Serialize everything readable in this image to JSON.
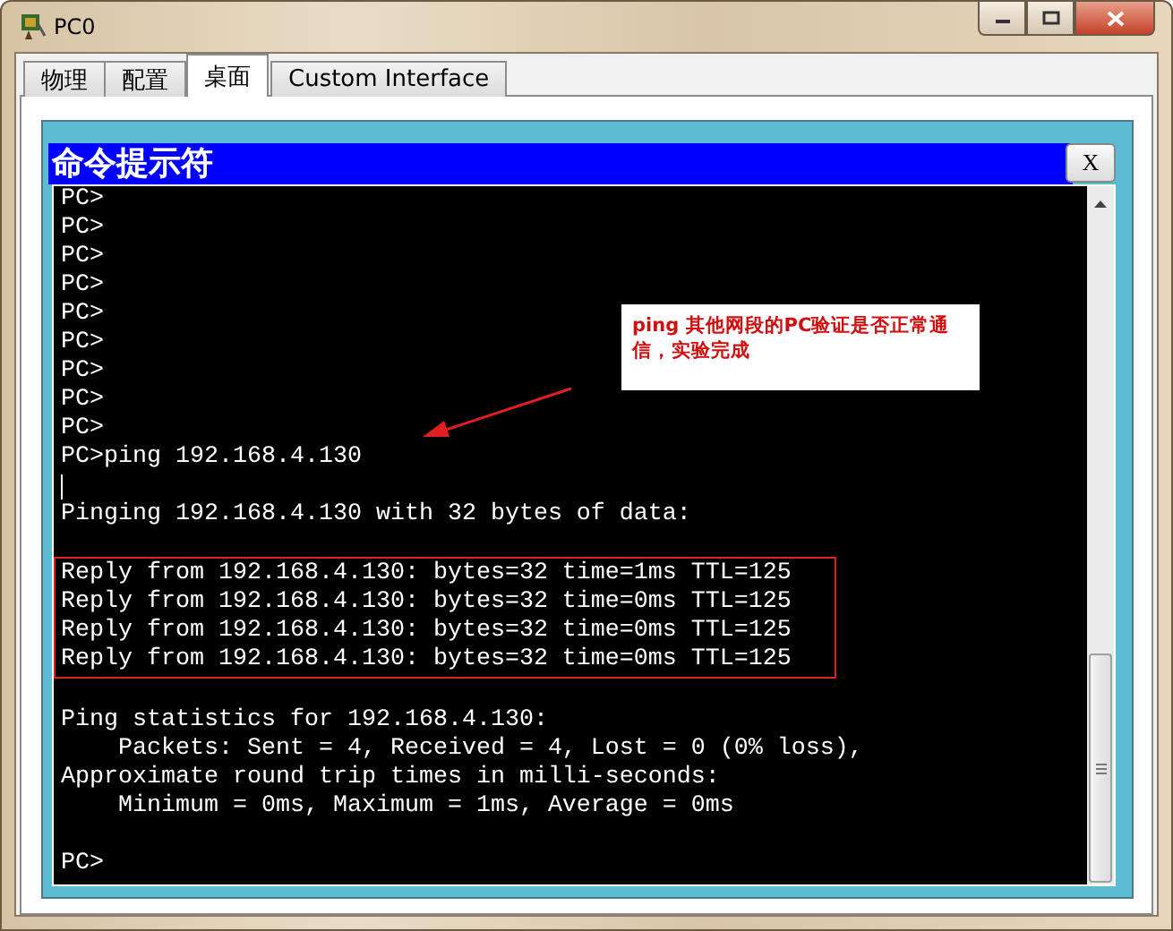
{
  "window": {
    "title": "PC0"
  },
  "tabs": [
    {
      "label": "物理",
      "selected": false
    },
    {
      "label": "配置",
      "selected": false
    },
    {
      "label": "桌面",
      "selected": true
    },
    {
      "label": "Custom Interface",
      "selected": false
    }
  ],
  "command_prompt": {
    "title": "命令提示符",
    "close": "X",
    "blocks": [
      {
        "boxed": false,
        "lines": [
          {
            "kind": "text",
            "text": "PC>"
          },
          {
            "kind": "text",
            "text": "PC>"
          },
          {
            "kind": "text",
            "text": "PC>"
          },
          {
            "kind": "text",
            "text": "PC>"
          },
          {
            "kind": "text",
            "text": "PC>"
          },
          {
            "kind": "text",
            "text": "PC>"
          },
          {
            "kind": "text",
            "text": "PC>"
          },
          {
            "kind": "text",
            "text": "PC>"
          },
          {
            "kind": "text",
            "text": "PC>"
          },
          {
            "kind": "text",
            "text": "PC>ping 192.168.4.130"
          },
          {
            "kind": "cursor"
          },
          {
            "kind": "text",
            "text": "Pinging 192.168.4.130 with 32 bytes of data:"
          },
          {
            "kind": "blank"
          }
        ]
      },
      {
        "boxed": true,
        "lines": [
          {
            "kind": "text",
            "text": "Reply from 192.168.4.130: bytes=32 time=1ms TTL=125"
          },
          {
            "kind": "text",
            "text": "Reply from 192.168.4.130: bytes=32 time=0ms TTL=125"
          },
          {
            "kind": "text",
            "text": "Reply from 192.168.4.130: bytes=32 time=0ms TTL=125"
          },
          {
            "kind": "text",
            "text": "Reply from 192.168.4.130: bytes=32 time=0ms TTL=125"
          }
        ]
      },
      {
        "boxed": false,
        "lines": [
          {
            "kind": "blank"
          },
          {
            "kind": "text",
            "text": "Ping statistics for 192.168.4.130:"
          },
          {
            "kind": "text",
            "text": "    Packets: Sent = 4, Received = 4, Lost = 0 (0% loss),"
          },
          {
            "kind": "text",
            "text": "Approximate round trip times in milli-seconds:"
          },
          {
            "kind": "text",
            "text": "    Minimum = 0ms, Maximum = 1ms, Average = 0ms"
          },
          {
            "kind": "blank"
          },
          {
            "kind": "text",
            "text": "PC>"
          }
        ]
      }
    ]
  },
  "annotation": {
    "text": "ping 其他网段的PC验证是否正常通信，实验完成"
  }
}
